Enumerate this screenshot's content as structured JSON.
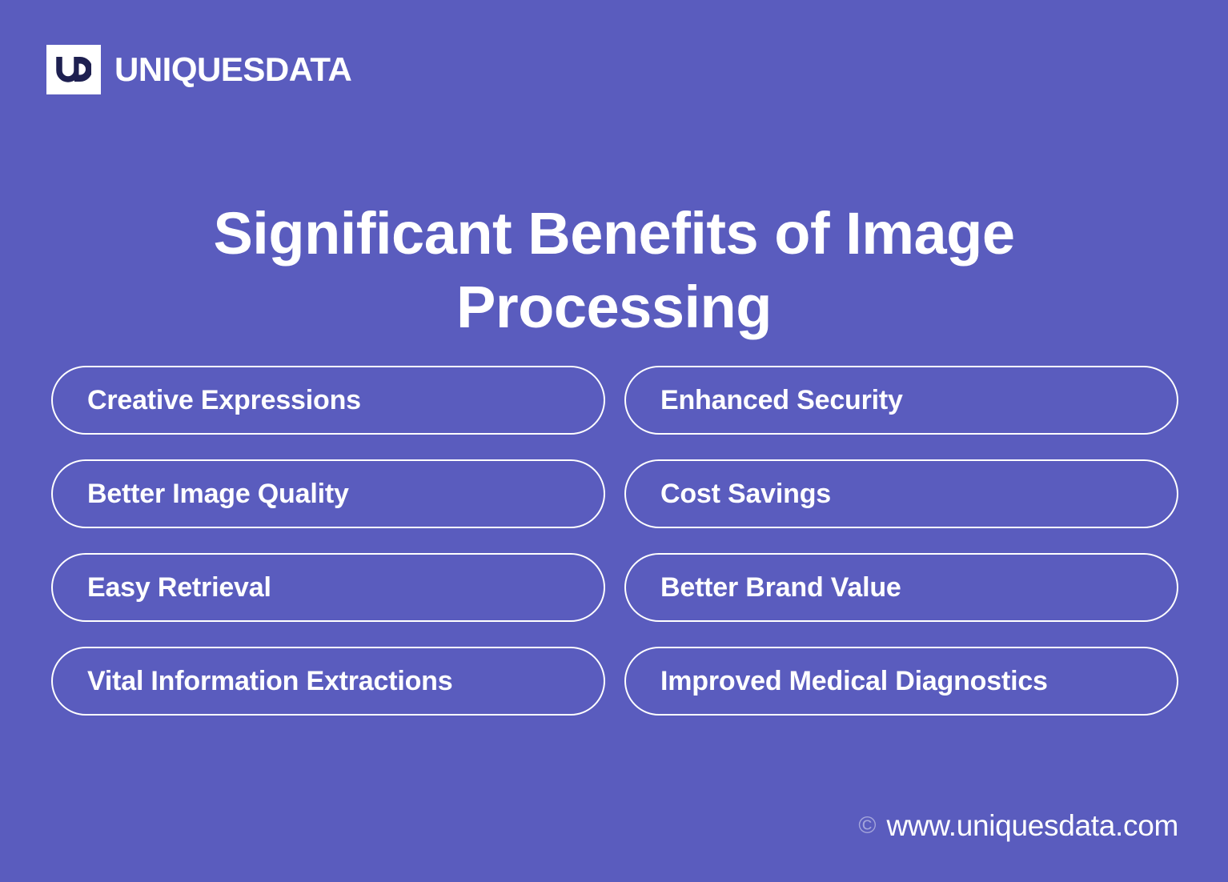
{
  "background_color": "#5a5cbe",
  "brand": {
    "mark_icon": "ud-monogram-icon",
    "mark_background": "#ffffff",
    "mark_color": "#1e2050",
    "name": "UNIQUESDATA"
  },
  "title": "Significant Benefits of Image Processing",
  "benefits": [
    "Creative Expressions",
    "Enhanced Security",
    "Better Image Quality",
    "Cost Savings",
    "Easy Retrieval",
    "Better Brand Value",
    "Vital Information Extractions",
    "Improved Medical Diagnostics"
  ],
  "footer": {
    "copyright_symbol": "©",
    "url": "www.uniquesdata.com"
  }
}
